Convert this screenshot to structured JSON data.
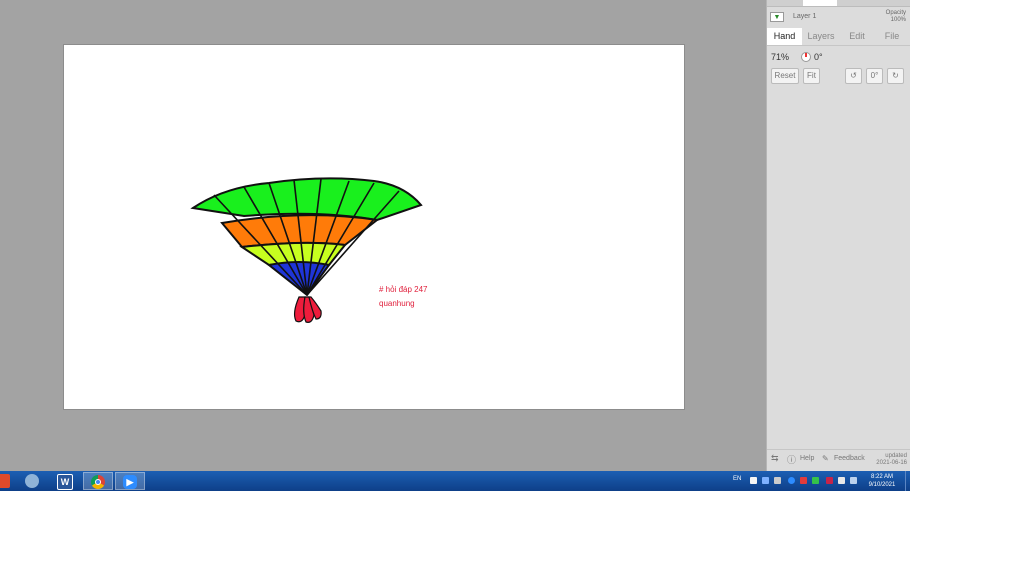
{
  "panel": {
    "layer_name": "Layer 1",
    "opacity_label": "Opacity",
    "opacity_value": "100%",
    "tabs": [
      "Hand",
      "Layers",
      "Edit",
      "File"
    ],
    "zoom": "71%",
    "rotation": "0°",
    "reset_label": "Reset",
    "fit_label": "Fit",
    "angle_label": "0°",
    "help_label": "Help",
    "feedback_label": "Feedback",
    "updated_label": "updated",
    "updated_date": "2021-06-16"
  },
  "canvas": {
    "note_line1": "# hỏi đáp 247",
    "note_line2": "quanhung",
    "note_color": "#e0203c",
    "fan_colors": {
      "outline": "#111111",
      "band_outer": "#19f01d",
      "band_second": "#ff7b09",
      "band_third": "#c7ff1f",
      "band_inner": "#1f35d8",
      "tassel": "#ee1c3c"
    }
  },
  "taskbar": {
    "word_glyph": "W",
    "lang": "EN",
    "time": "8:22 AM",
    "date": "9/10/2021",
    "icons": [
      "paint-icon",
      "settings-icon",
      "word-icon",
      "chrome-icon",
      "zoom-icon"
    ]
  }
}
